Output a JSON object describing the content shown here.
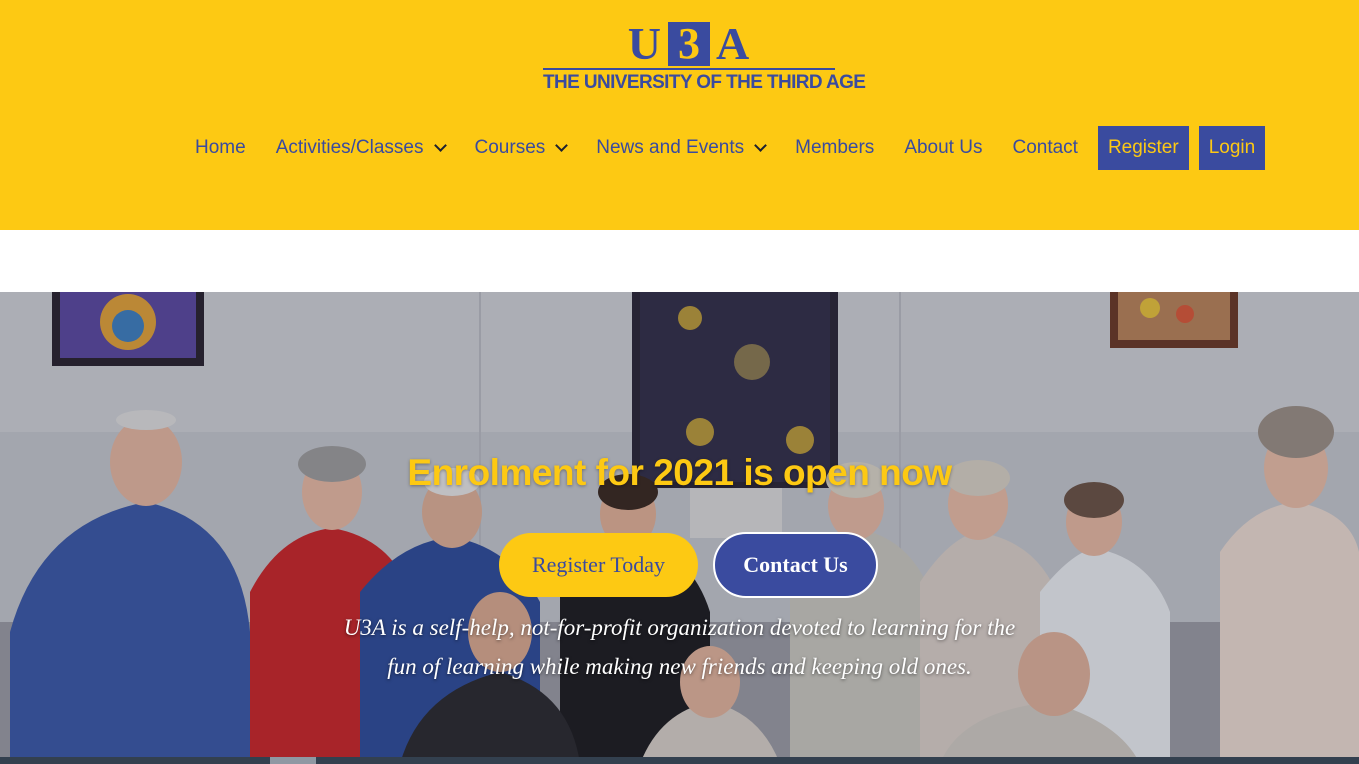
{
  "logo": {
    "letters": [
      "U",
      "3",
      "A"
    ],
    "tagline": "THE UNIVERSITY OF THE THIRD AGE"
  },
  "nav": {
    "items": [
      {
        "label": "Home",
        "dropdown": false
      },
      {
        "label": "Activities/Classes",
        "dropdown": true
      },
      {
        "label": "Courses",
        "dropdown": true
      },
      {
        "label": "News and Events",
        "dropdown": true
      },
      {
        "label": "Members",
        "dropdown": false
      },
      {
        "label": "About Us",
        "dropdown": false
      },
      {
        "label": "Contact",
        "dropdown": false
      }
    ],
    "register_label": "Register",
    "login_label": "Login"
  },
  "hero": {
    "heading": "Enrolment for 2021 is open now",
    "register_button": "Register Today",
    "contact_button": "Contact Us",
    "text_line1": "U3A is a self-help, not-for-profit organization devoted to learning for the",
    "text_line2": "fun of learning while making new friends and keeping old ones."
  },
  "colors": {
    "brand_yellow": "#fdc913",
    "brand_blue": "#3a4b9f",
    "white": "#ffffff"
  }
}
